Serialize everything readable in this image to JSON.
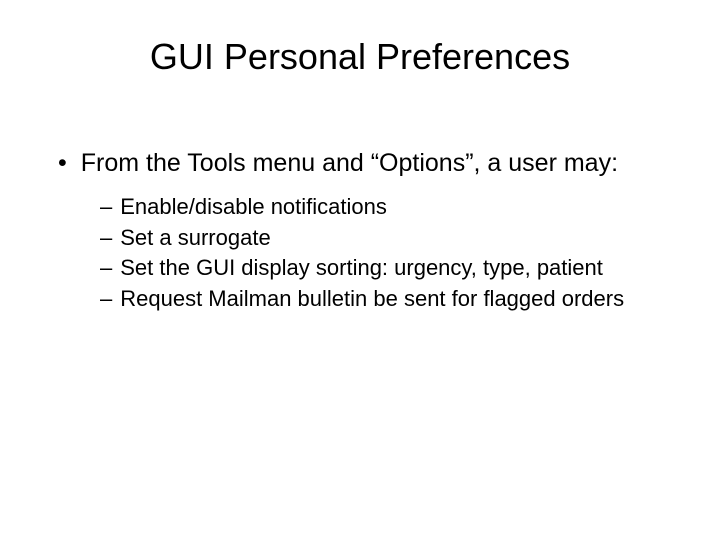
{
  "title": "GUI Personal Preferences",
  "main_bullet": "From the Tools menu and “Options”, a user may:",
  "subitems": [
    "Enable/disable notifications",
    "Set a surrogate",
    "Set the GUI display sorting: urgency, type, patient",
    "Request Mailman bulletin be sent for flagged orders"
  ]
}
